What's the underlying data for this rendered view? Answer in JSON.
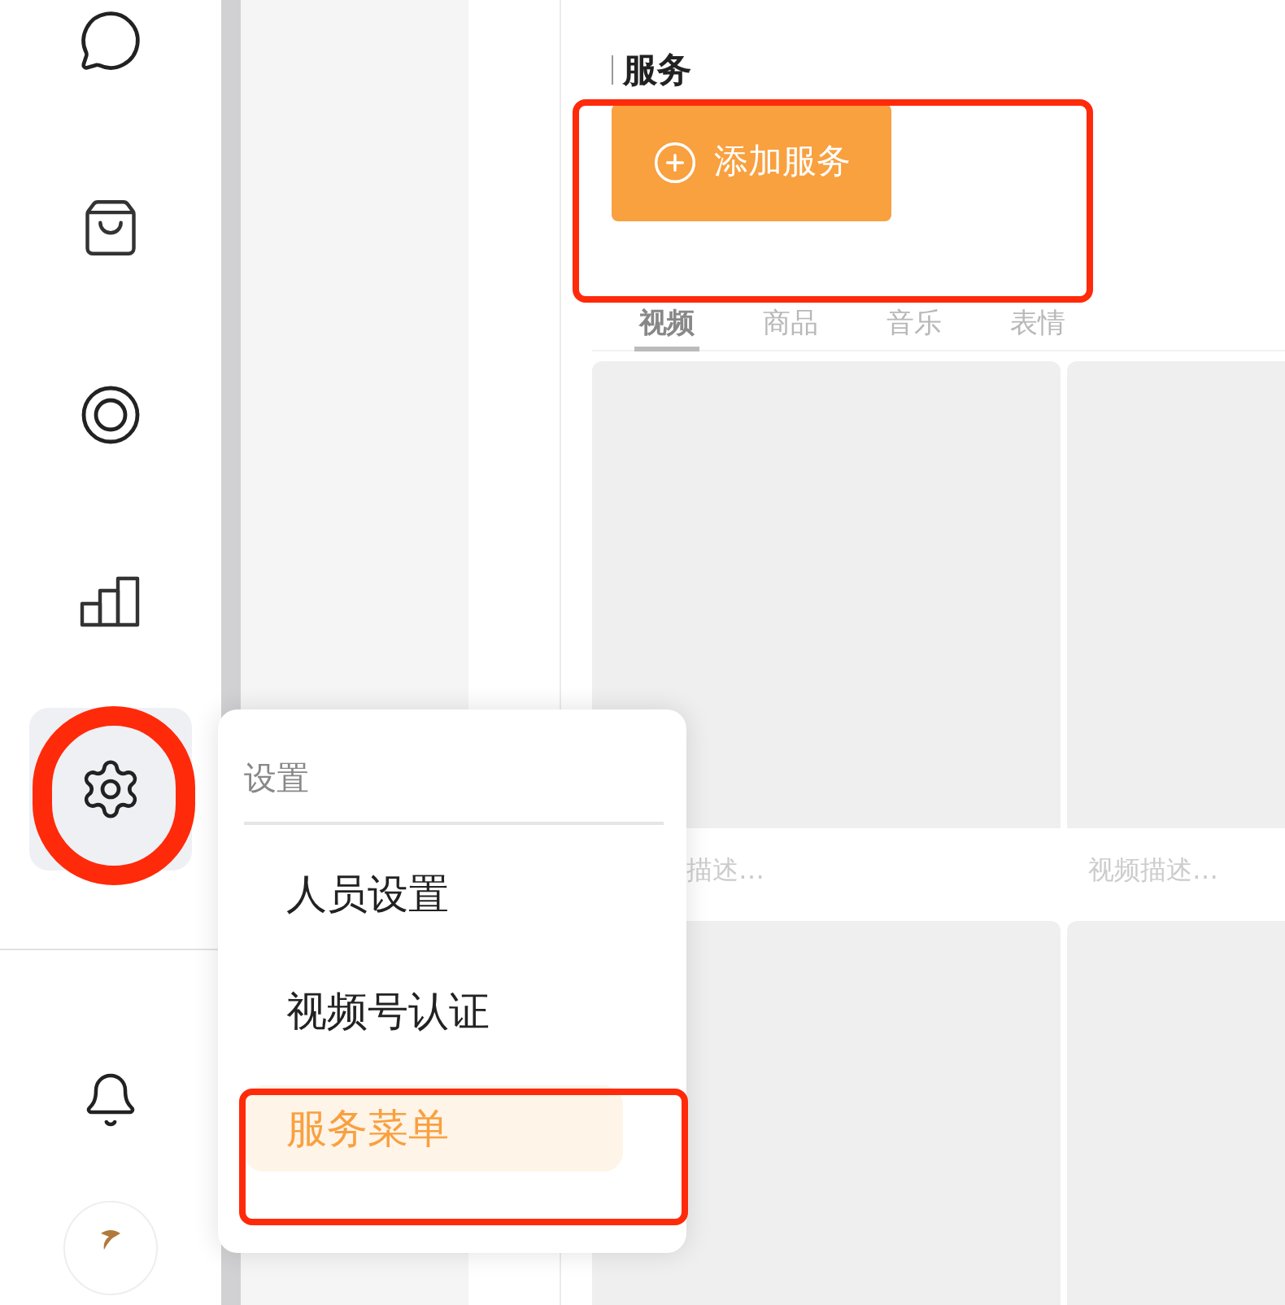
{
  "sidebar": {
    "items": [
      {
        "selected": false
      },
      {
        "selected": false
      },
      {
        "selected": false
      },
      {
        "selected": false
      },
      {
        "selected": true
      }
    ]
  },
  "section": {
    "title": "服务",
    "add_button": "添加服务"
  },
  "tabs": [
    {
      "label": "视频",
      "selected": true
    },
    {
      "label": "商品",
      "selected": false
    },
    {
      "label": "音乐",
      "selected": false
    },
    {
      "label": "表情",
      "selected": false
    }
  ],
  "cards": [
    {
      "caption": "描述…"
    },
    {
      "caption": "视频描述…"
    }
  ],
  "menu": {
    "title": "设置",
    "items": [
      {
        "label": "人员设置",
        "selected": false
      },
      {
        "label": "视频号认证",
        "selected": false
      },
      {
        "label": "服务菜单",
        "selected": true
      }
    ]
  }
}
